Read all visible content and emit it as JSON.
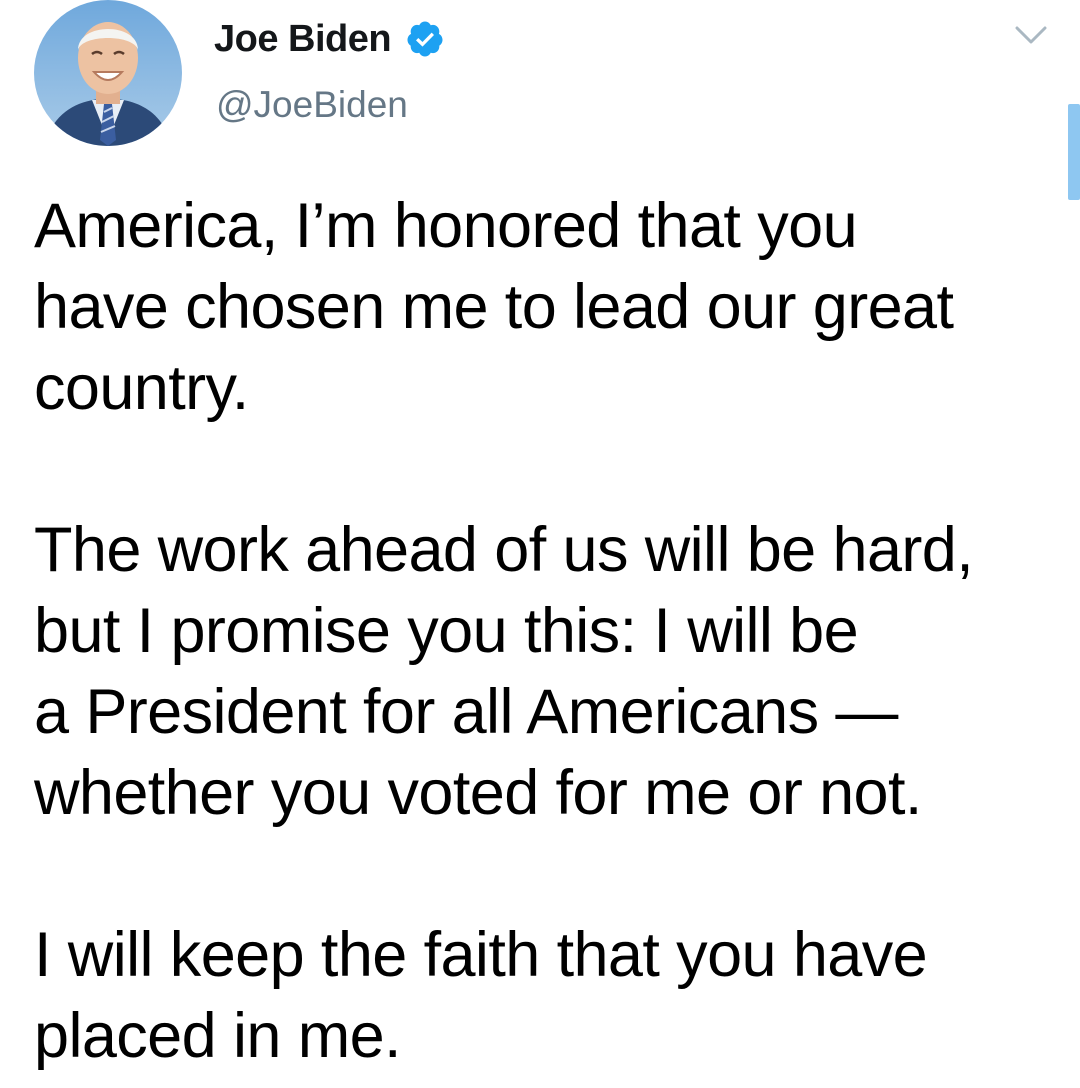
{
  "author": {
    "display_name": "Joe Biden",
    "handle": "@JoeBiden",
    "verified": true,
    "avatar_icon": "profile-photo"
  },
  "colors": {
    "verified_blue": "#1da1f2",
    "handle_gray": "#657786",
    "scroll_indicator": "#8ec7f1",
    "text": "#000000"
  },
  "tweet": {
    "paragraphs": [
      {
        "lines": [
          "America, I’m honored that you",
          "have chosen me to lead our great",
          "country."
        ]
      },
      {
        "lines": [
          "The work ahead of us will be hard,",
          "but I promise you this: I will be",
          "a President for all Americans —",
          "whether you voted for me or not."
        ]
      },
      {
        "lines": [
          "I will keep the faith that you have",
          "placed in me."
        ]
      }
    ]
  },
  "icons": {
    "menu": "chevron-down-icon",
    "verified": "verified-badge-icon"
  }
}
